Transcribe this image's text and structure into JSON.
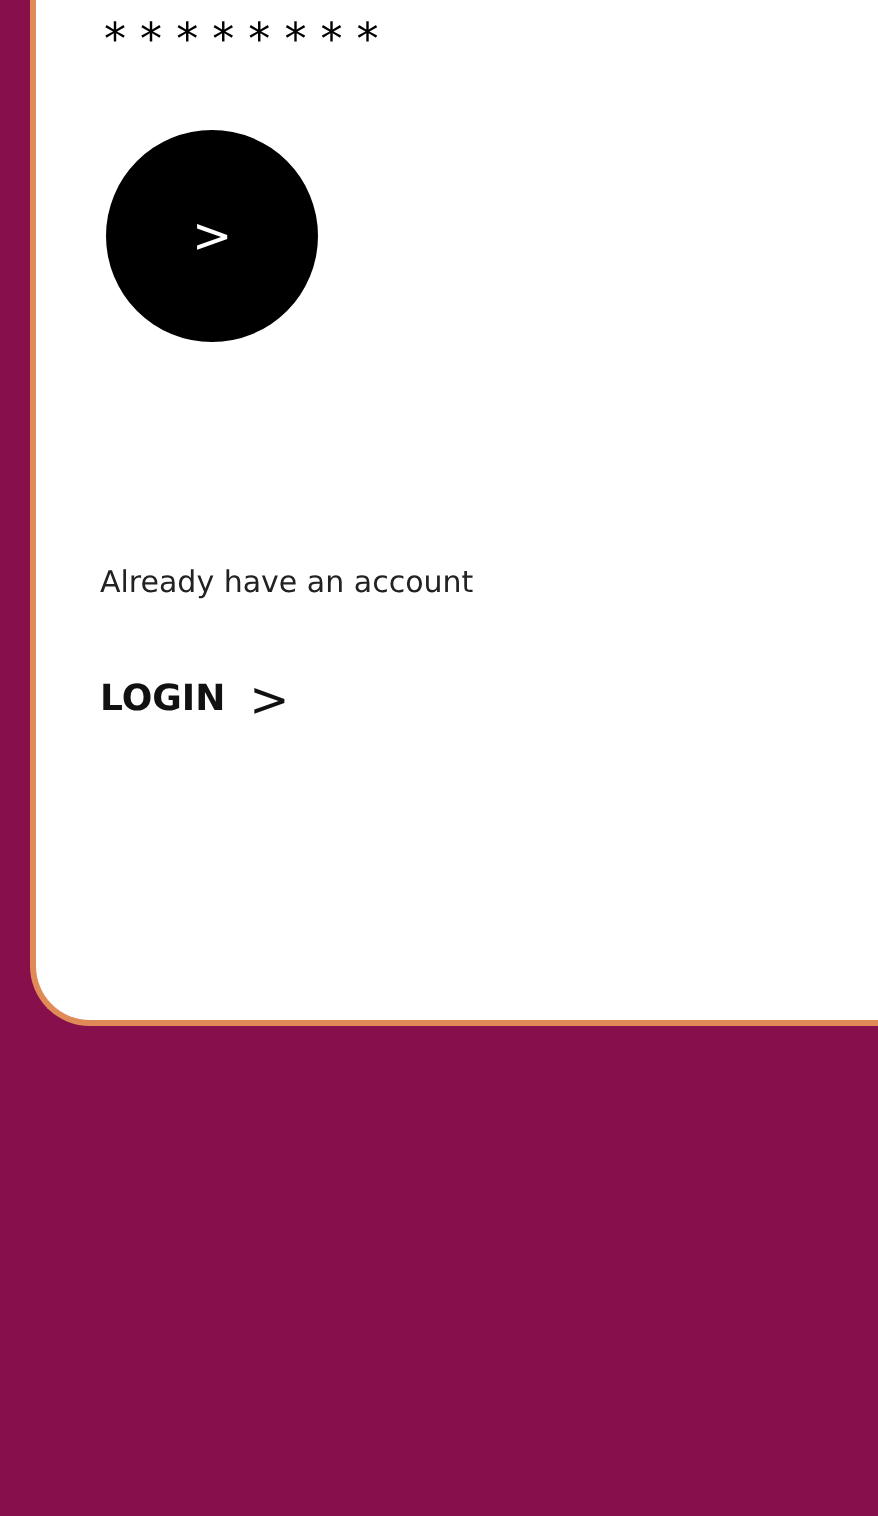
{
  "password_field": {
    "value": "********"
  },
  "submit_button": {
    "label": ">"
  },
  "prompt": "Already have an account",
  "login_link": {
    "label": "LOGIN",
    "arrow": ">"
  }
}
